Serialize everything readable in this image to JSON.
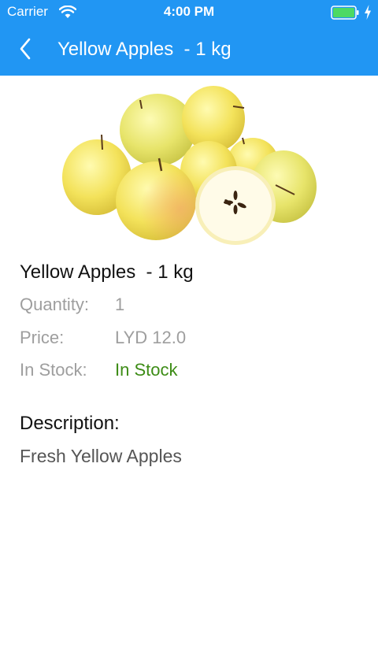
{
  "status_bar": {
    "carrier": "Carrier",
    "time": "4:00 PM",
    "wifi_icon": "wifi-icon",
    "battery_icon": "battery-icon",
    "charging_icon": "charging-bolt-icon",
    "battery_color": "#4cd964"
  },
  "nav": {
    "back_icon": "chevron-left-icon",
    "title": "Yellow Apples  - 1 kg"
  },
  "product": {
    "image_icon": "yellow-apples-image",
    "name": "Yellow Apples  - 1 kg",
    "details": [
      {
        "label": "Quantity:",
        "value": "1"
      },
      {
        "label": "Price:",
        "value": "LYD 12.0"
      },
      {
        "label": "In Stock:",
        "value": "In Stock"
      }
    ],
    "description_title": "Description:",
    "description": "Fresh Yellow Apples"
  },
  "colors": {
    "accent": "#2196f3",
    "in_stock": "#3d8c16",
    "muted_text": "#9e9e9e"
  }
}
